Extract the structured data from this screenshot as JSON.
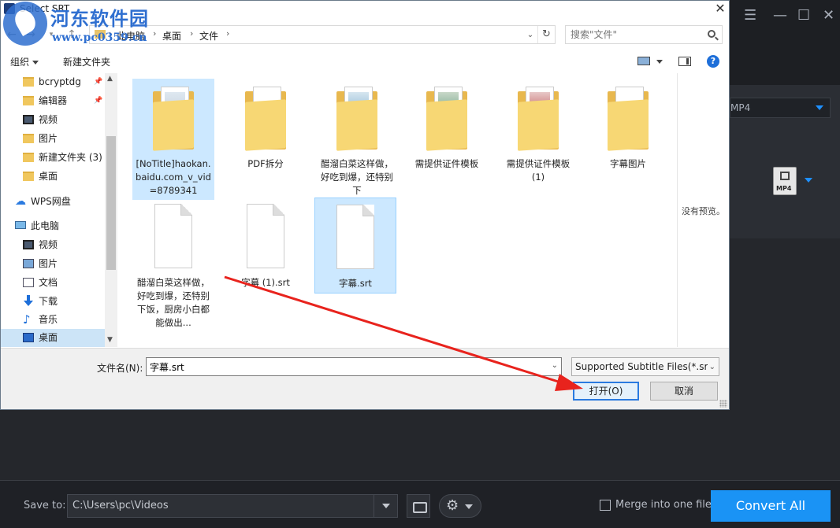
{
  "dialog": {
    "title": "Select SRT",
    "close_glyph": "✕",
    "breadcrumb": [
      "此电脑",
      "桌面",
      "文件"
    ],
    "search_placeholder": "搜索\"文件\"",
    "toolbar": {
      "organize": "组织",
      "new_folder": "新建文件夹"
    },
    "help_glyph": "?",
    "nav": [
      {
        "label": "bcryptdg",
        "icon": "folder",
        "pinned": true
      },
      {
        "label": "编辑器",
        "icon": "folder",
        "pinned": true
      },
      {
        "label": "视频",
        "icon": "video"
      },
      {
        "label": "图片",
        "icon": "folder"
      },
      {
        "label": "新建文件夹 (3)",
        "icon": "folder"
      },
      {
        "label": "桌面",
        "icon": "folder"
      },
      {
        "label": "WPS网盘",
        "icon": "cloud"
      },
      {
        "label": "此电脑",
        "icon": "pc"
      },
      {
        "label": "视频",
        "icon": "video"
      },
      {
        "label": "图片",
        "icon": "picture"
      },
      {
        "label": "文档",
        "icon": "doc"
      },
      {
        "label": "下载",
        "icon": "download"
      },
      {
        "label": "音乐",
        "icon": "music"
      },
      {
        "label": "桌面",
        "icon": "desktop",
        "selected": true
      }
    ],
    "files": [
      {
        "name": "[NoTitle]haokan.baidu.com_v_vid=8789341",
        "type": "folder"
      },
      {
        "name": "PDF拆分",
        "type": "folder"
      },
      {
        "name": "醋溜白菜这样做，好吃到爆，还特别下",
        "type": "folder"
      },
      {
        "name": "需提供证件模板",
        "type": "folder"
      },
      {
        "name": "需提供证件模板 (1)",
        "type": "folder"
      },
      {
        "name": "字幕图片",
        "type": "folder"
      },
      {
        "name": "醋溜白菜这样做，好吃到爆，还特别下饭，厨房小白都能做出...",
        "type": "file"
      },
      {
        "name": "字幕 (1).srt",
        "type": "file"
      },
      {
        "name": "字幕.srt",
        "type": "file",
        "selected": true
      }
    ],
    "preview_text": "没有预览。",
    "filename_label": "文件名(N):",
    "filename_value": "字幕.srt",
    "filetype_value": "Supported Subtitle Files(*.srt",
    "open_label": "打开(O)",
    "cancel_label": "取消"
  },
  "app": {
    "format_value": "MP4",
    "format_icon_label": "MP4",
    "save_to_label": "Save to:",
    "save_path": "C:\\Users\\pc\\Videos",
    "merge_label": "Merge into one file",
    "convert_label": "Convert All",
    "window_controls": [
      "☰",
      "—",
      "☐",
      "✕"
    ]
  },
  "watermark": {
    "brand": "河东软件园",
    "url": "www.pc0359.cn"
  },
  "colors": {
    "accent": "#1a93f5",
    "selection": "#cce8ff",
    "arrow": "#e8231d",
    "folder": "#f7d774"
  }
}
